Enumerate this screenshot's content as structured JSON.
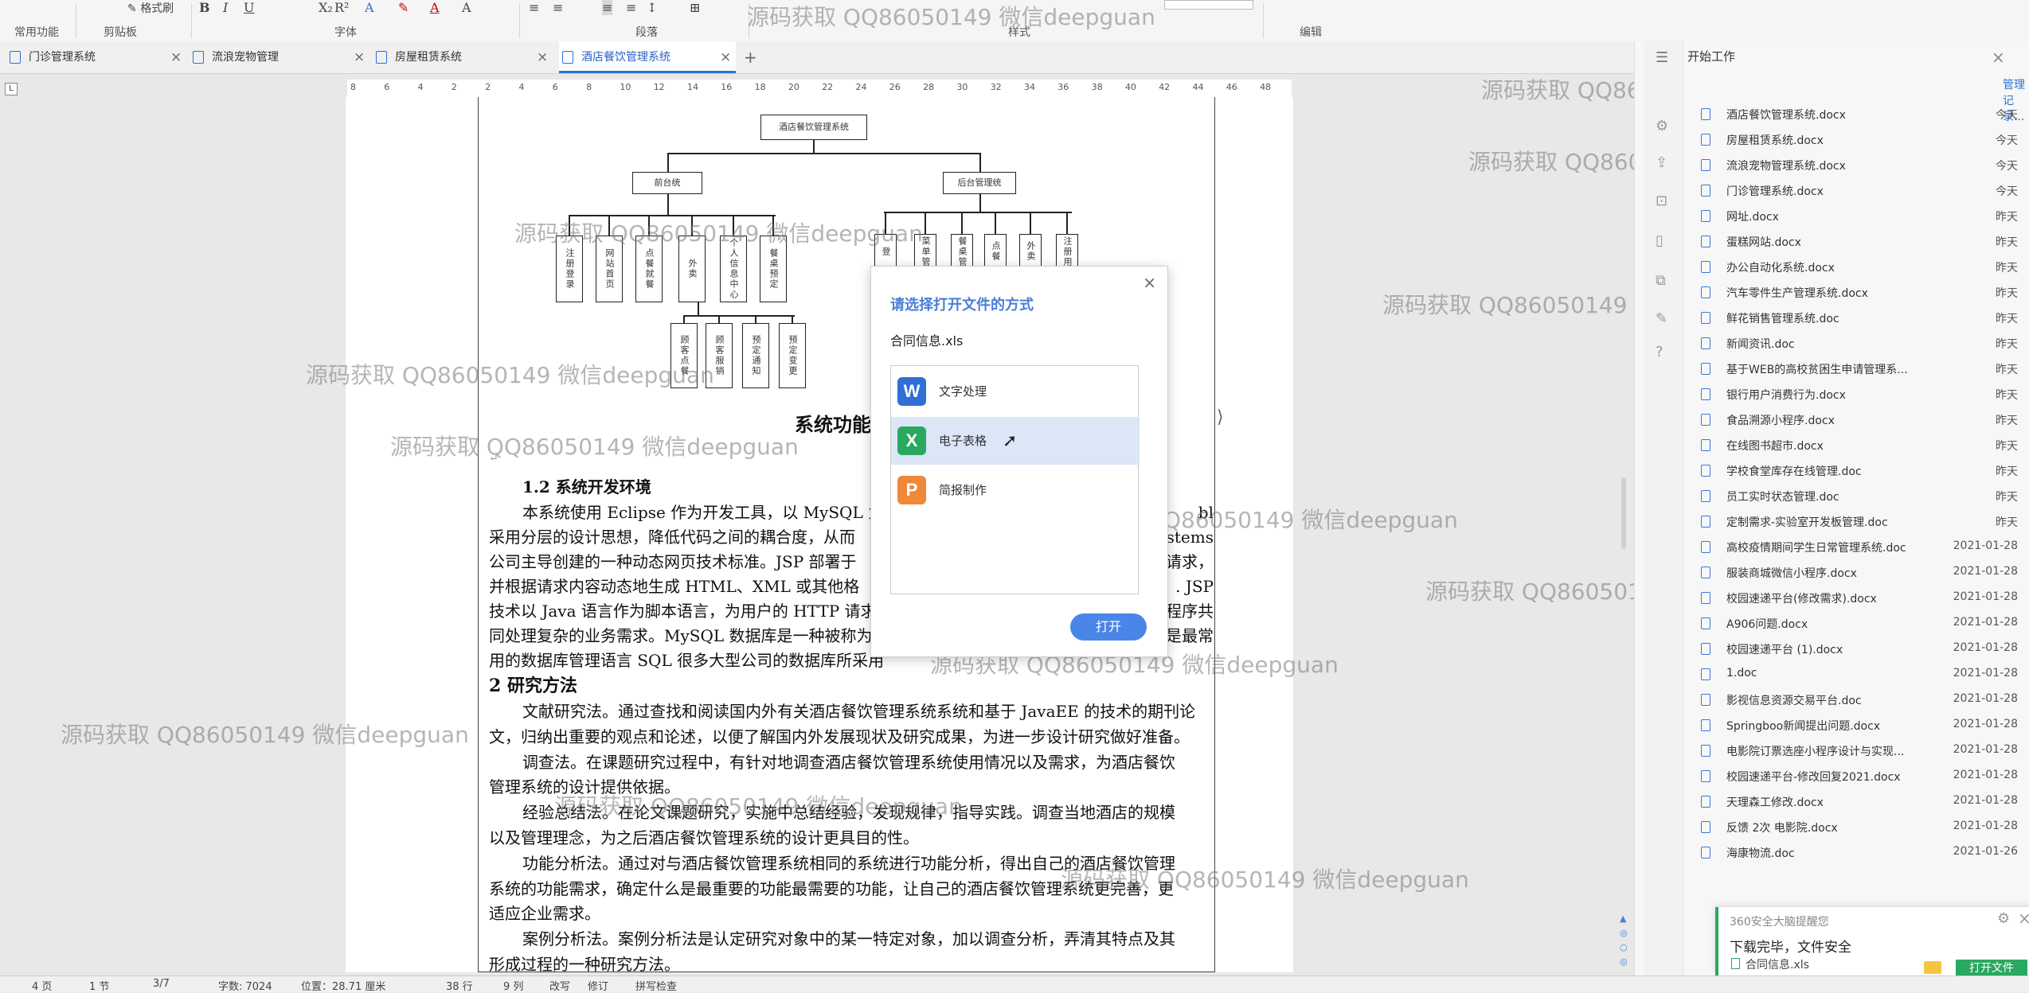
{
  "ribbon": {
    "groups": [
      "常用功能",
      "剪贴板",
      "字体",
      "段落",
      "样式",
      "编辑"
    ],
    "format_painter": "格式刷"
  },
  "tabs": [
    {
      "label": "门诊管理系统"
    },
    {
      "label": "流浪宠物管理"
    },
    {
      "label": "房屋租赁系统"
    },
    {
      "label": "酒店餐饮管理系统"
    }
  ],
  "new_tab": "+",
  "ruler": {
    "ticks": [
      "8",
      "6",
      "4",
      "2",
      "2",
      "4",
      "6",
      "8",
      "10",
      "12",
      "14",
      "16",
      "18",
      "20",
      "22",
      "24",
      "26",
      "28",
      "30",
      "32",
      "34",
      "36",
      "38",
      "40",
      "42",
      "44",
      "46",
      "48"
    ]
  },
  "diagram": {
    "root": "酒店餐饮管理系统",
    "front": "前台统",
    "back": "后台管理统",
    "front_children": [
      "注册登录",
      "网站首页",
      "点餐就餐",
      "外卖",
      "个人信息中心",
      "餐桌预定"
    ],
    "sub_children": [
      "顾客点餐",
      "顾客服销",
      "预定通知",
      "预定变更"
    ],
    "back_children": [
      "登",
      "菜单管",
      "餐桌管",
      "点餐",
      "外卖",
      "注册用"
    ]
  },
  "doc": {
    "fig_caption": "系统功能",
    "h_1_2": "1.2 系统开发环境",
    "p1": [
      "本系统使用 Eclipse 作为开发工具，以 MySQL 为",
      "采用分层的设计思想，降低代码之间的耦合度，从而",
      "公司主导创建的一种动态网页技术标准。JSP 部署于",
      "并根据请求内容动态地生成 HTML、XML 或其他格",
      "技术以 Java 语言作为脚本语言，为用户的 HTTP 请求",
      "同处理复杂的业务需求。MySQL 数据库是一种被称为",
      "用的数据库管理语言 SQL 很多大型公司的数据库所采用"
    ],
    "p1_right": [
      "bl",
      "ystems",
      "请求，",
      ". JSP",
      "程序共",
      "是最常",
      ""
    ],
    "h_2": "2 研究方法",
    "paras": [
      "文献研究法。通过查找和阅读国内外有关酒店餐饮管理系统系统和基于 JavaEE 的技术的期刊论",
      "文，归纳出重要的观点和论述，以便了解国内外发展现状及研究成果，为进一步设计研究做好准备。",
      "调查法。在课题研究过程中，有针对地调查酒店餐饮管理系统使用情况以及需求，为酒店餐饮",
      "管理系统的设计提供依据。",
      "经验总结法。在论文课题研究，实施中总结经验，发现规律，指导实践。调查当地酒店的规模",
      "以及管理理念，为之后酒店餐饮管理系统的设计更具目的性。",
      "功能分析法。通过对与酒店餐饮管理系统相同的系统进行功能分析，得出自己的酒店餐饮管理",
      "系统的功能需求，确定什么是最重要的功能最需要的功能，让自己的酒店餐饮管理系统更完善，更",
      "适应企业需求。",
      "案例分析法。案例分析法是认定研究对象中的某一特定对象，加以调查分析，弄清其特点及其",
      "形成过程的一种研究方法。"
    ]
  },
  "dialog": {
    "title": "请选择打开文件的方式",
    "filename": "合同信息.xls",
    "options": [
      "文字处理",
      "电子表格",
      "简报制作"
    ],
    "open_button": "打开",
    "close": "×"
  },
  "right_panel": {
    "title": "开始工作",
    "manage": "管理记录...",
    "files": [
      {
        "name": "酒店餐饮管理系统.docx",
        "date": "今天"
      },
      {
        "name": "房屋租赁系统.docx",
        "date": "今天"
      },
      {
        "name": "流浪宠物管理系统.docx",
        "date": "今天"
      },
      {
        "name": "门诊管理系统.docx",
        "date": "今天"
      },
      {
        "name": "网址.docx",
        "date": "昨天"
      },
      {
        "name": "蛋糕网站.docx",
        "date": "昨天"
      },
      {
        "name": "办公自动化系统.docx",
        "date": "昨天"
      },
      {
        "name": "汽车零件生产管理系统.docx",
        "date": "昨天"
      },
      {
        "name": "鲜花销售管理系统.doc",
        "date": "昨天"
      },
      {
        "name": "新闻资讯.doc",
        "date": "昨天"
      },
      {
        "name": "基于WEB的高校贫困生申请管理系...",
        "date": "昨天"
      },
      {
        "name": "银行用户消费行为.docx",
        "date": "昨天"
      },
      {
        "name": "食品溯源小程序.docx",
        "date": "昨天"
      },
      {
        "name": "在线图书超市.docx",
        "date": "昨天"
      },
      {
        "name": "学校食堂库存在线管理.doc",
        "date": "昨天"
      },
      {
        "name": "员工实时状态管理.doc",
        "date": "昨天"
      },
      {
        "name": "定制需求-实验室开发板管理.doc",
        "date": "昨天"
      },
      {
        "name": "高校疫情期间学生日常管理系统.doc",
        "date": "2021-01-28"
      },
      {
        "name": "服装商城微信小程序.docx",
        "date": "2021-01-28"
      },
      {
        "name": "校园速递平台(修改需求).docx",
        "date": "2021-01-28"
      },
      {
        "name": "A906问题.docx",
        "date": "2021-01-28"
      },
      {
        "name": "校园速递平台 (1).docx",
        "date": "2021-01-28"
      },
      {
        "name": "1.doc",
        "date": "2021-01-28"
      },
      {
        "name": "影视信息资源交易平台.doc",
        "date": "2021-01-28"
      },
      {
        "name": "Springboo新闻提出问题.docx",
        "date": "2021-01-28"
      },
      {
        "name": "电影院订票选座小程序设计与实现...",
        "date": "2021-01-28"
      },
      {
        "name": "校园速递平台-修改回复2021.docx",
        "date": "2021-01-28"
      },
      {
        "name": "天理森工修改.docx",
        "date": "2021-01-28"
      },
      {
        "name": "反馈 2次 电影院.docx",
        "date": "2021-01-28"
      },
      {
        "name": "海康物流.doc",
        "date": "2021-01-26"
      }
    ]
  },
  "notification": {
    "title": "360安全大脑提醒您",
    "message": "下载完毕，文件安全",
    "file": "合同信息.xls",
    "button": "打开文件"
  },
  "status": {
    "pages": "4 页",
    "section": "1 节",
    "page_of": "3/7",
    "words": "字数: 7024",
    "position": "位置：28.71 厘米",
    "row": "38 行",
    "col": "9 列",
    "rev": "改写",
    "track": "修订",
    "spell": "拼写检查"
  },
  "watermark": "源码获取 QQ86050149 微信deepguan"
}
